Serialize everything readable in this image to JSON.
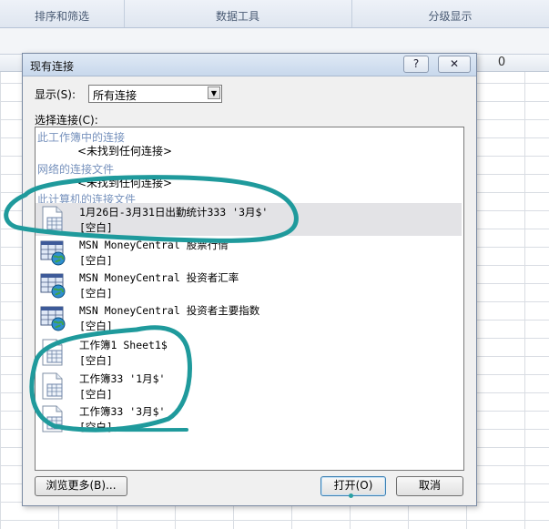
{
  "ribbon": {
    "groups": [
      {
        "label": "排序和筛选"
      },
      {
        "label": "数据工具"
      },
      {
        "label": "分级显示"
      }
    ]
  },
  "sheet": {
    "col_label": "0"
  },
  "dialog": {
    "title": "现有连接",
    "help_label": "?",
    "close_label": "✕",
    "show_label": "显示(S):",
    "show_value": "所有连接",
    "choose_label": "选择连接(C):",
    "sections": {
      "workbook": "此工作簿中的连接",
      "workbook_empty": "<未找到任何连接>",
      "network": "网络的连接文件",
      "network_empty": "<未找到任何连接>",
      "computer": "此计算机的连接文件"
    },
    "items": [
      {
        "name": "1月26日-3月31日出勤统计333 '3月$'",
        "desc": "[空白]",
        "icon": "table-file-icon"
      },
      {
        "name": "MSN MoneyCentral 股票行情",
        "desc": "[空白]",
        "icon": "web-query-icon"
      },
      {
        "name": "MSN MoneyCentral 投资者汇率",
        "desc": "[空白]",
        "icon": "web-query-icon"
      },
      {
        "name": "MSN MoneyCentral 投资者主要指数",
        "desc": "[空白]",
        "icon": "web-query-icon"
      },
      {
        "name": "工作簿1 Sheet1$",
        "desc": "[空白]",
        "icon": "table-file-icon"
      },
      {
        "name": "工作簿33 '1月$'",
        "desc": "[空白]",
        "icon": "table-file-icon"
      },
      {
        "name": "工作簿33 '3月$'",
        "desc": "[空白]",
        "icon": "table-file-icon"
      }
    ],
    "browse_label": "浏览更多(B)...",
    "open_label": "打开(O)",
    "cancel_label": "取消"
  },
  "colors": {
    "annotation": "#1f9a9c",
    "section_text": "#7792bd"
  }
}
